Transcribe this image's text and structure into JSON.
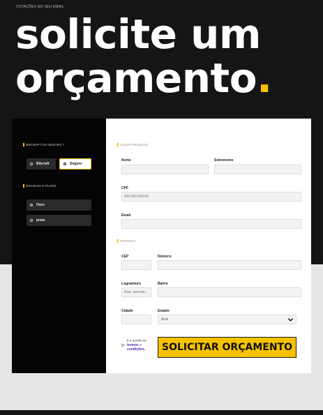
{
  "header": {
    "eyebrow": "COTAÇÕES NO SEU EMAIL",
    "headline_line1": "solicite um",
    "headline_line2": "orçamento",
    "headline_dot": "."
  },
  "sidebar": {
    "question_label": "BIKCRAFT OU SEGURO ?",
    "product_options": [
      {
        "label": "Bikcraft",
        "selected": false
      },
      {
        "label": "Seguro",
        "selected": true
      }
    ],
    "plan_label": "ESCOLHA O PLANO:",
    "plan_options": [
      {
        "label": "Ouro"
      },
      {
        "label": "prata"
      }
    ]
  },
  "form": {
    "personal_section": "DADOS PESSOAIS",
    "nome_label": "Nome",
    "sobrenome_label": "Sobrenome",
    "cpf_label": "CPF",
    "cpf_placeholder": "000.000.000-00",
    "email_label": "Email",
    "delivery_section": "ENTREGA",
    "cep_label": "CEP",
    "numero_label": "Número:",
    "logradouro_label": "Logradouro",
    "logradouro_placeholder": "Rua, avenida...",
    "bairro_label": "Bairro",
    "cidade_label": "Cidade",
    "estado_label": "Estado",
    "estado_value": "Acre",
    "terms_prefix": "li e aceito os",
    "terms_link": "termos",
    "terms_and": "e",
    "terms_link2": "condições.",
    "submit_label": "SOLICITAR ORÇAMENTO"
  },
  "colors": {
    "accent": "#f7c200",
    "dark": "#151515",
    "link": "#4b2bb0"
  }
}
